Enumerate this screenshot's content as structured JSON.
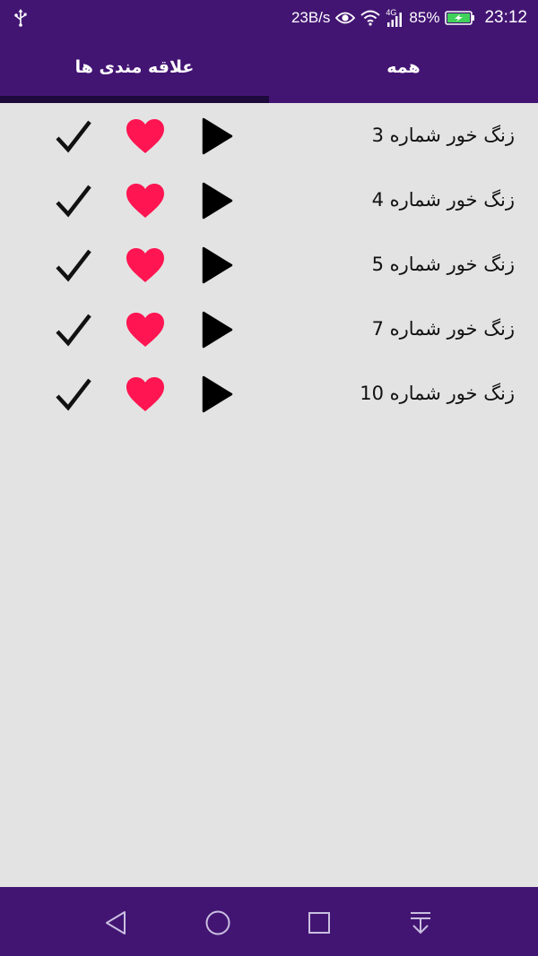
{
  "status_bar": {
    "speed": "23B/s",
    "network": "4G",
    "battery": "85%",
    "time": "23:12"
  },
  "tabs": [
    {
      "label": "علاقه مندی ها",
      "selected": true
    },
    {
      "label": "همه",
      "selected": false
    }
  ],
  "ringtones": [
    {
      "label": "زنگ خور شماره 3"
    },
    {
      "label": "زنگ خور شماره 4"
    },
    {
      "label": "زنگ خور شماره 5"
    },
    {
      "label": "زنگ خور شماره 7"
    },
    {
      "label": "زنگ خور شماره 10"
    }
  ],
  "icons": {
    "play": "play-icon",
    "favorite": "heart-icon",
    "select": "checkmark-icon"
  },
  "colors": {
    "primary": "#431573",
    "tab_indicator": "#1f0a3c",
    "heart": "#ff1551",
    "background": "#e3e3e3"
  }
}
